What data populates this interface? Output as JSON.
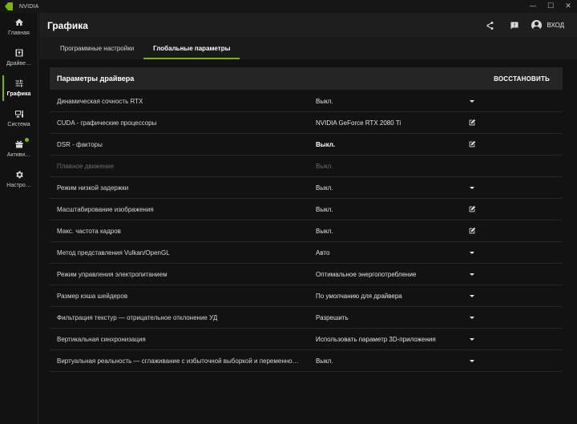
{
  "app": {
    "title": "NVIDIA"
  },
  "window": {
    "minimize": "—",
    "maximize": "☐",
    "close": "✕"
  },
  "sidebar": {
    "items": [
      {
        "label": "Главная",
        "icon": "home-icon"
      },
      {
        "label": "Драйве…",
        "icon": "driver-icon"
      },
      {
        "label": "Графика",
        "icon": "graphics-sliders-icon",
        "active": true
      },
      {
        "label": "Система",
        "icon": "system-icon"
      },
      {
        "label": "Активи…",
        "icon": "gift-icon",
        "badge": true
      },
      {
        "label": "Настро…",
        "icon": "gear-icon"
      }
    ]
  },
  "header": {
    "title": "Графика",
    "share_icon": "share-icon",
    "feedback_icon": "feedback-icon",
    "login_label": "ВХОД"
  },
  "tabs": [
    {
      "label": "Программные настройки",
      "active": false
    },
    {
      "label": "Глобальные параметры",
      "active": true
    }
  ],
  "panel": {
    "title": "Параметры драйвера",
    "restore_label": "ВОССТАНОВИТЬ"
  },
  "settings": [
    {
      "label": "Динамическая сочность RTX",
      "value": "Выкл.",
      "control": "dropdown"
    },
    {
      "label": "CUDA - графические процессоры",
      "value": "NVIDIA GeForce RTX 2080 Ti",
      "control": "edit"
    },
    {
      "label": "DSR - факторы",
      "value": "Выкл.",
      "control": "edit",
      "bold": true
    },
    {
      "label": "Плавное движение",
      "value": "Выкл.",
      "control": "none",
      "disabled": true
    },
    {
      "label": "Режим низкой задержки",
      "value": "Выкл.",
      "control": "dropdown"
    },
    {
      "label": "Масштабирование изображения",
      "value": "Выкл.",
      "control": "edit"
    },
    {
      "label": "Макс. частота кадров",
      "value": "Выкл.",
      "control": "edit"
    },
    {
      "label": "Метод представления Vulkan/OpenGL",
      "value": "Авто",
      "control": "dropdown"
    },
    {
      "label": "Режим управления электропитанием",
      "value": "Оптимальное энергопотребление",
      "control": "dropdown"
    },
    {
      "label": "Размер кэша шейдеров",
      "value": "По умолчанию для драйвера",
      "control": "dropdown"
    },
    {
      "label": "Фильтрация текстур — отрицательное отклонение УД",
      "value": "Разрешить",
      "control": "dropdown"
    },
    {
      "label": "Вертикальная синхронизация",
      "value": "Использовать параметр 3D-приложения",
      "control": "dropdown"
    },
    {
      "label": "Виртуальная реальность — сглаживание с избыточной выборкой и переменно…",
      "value": "Выкл.",
      "control": "dropdown"
    }
  ],
  "colors": {
    "accent": "#76b900",
    "background": "#121212",
    "header": "#1e1e1e",
    "panel": "#252525"
  }
}
